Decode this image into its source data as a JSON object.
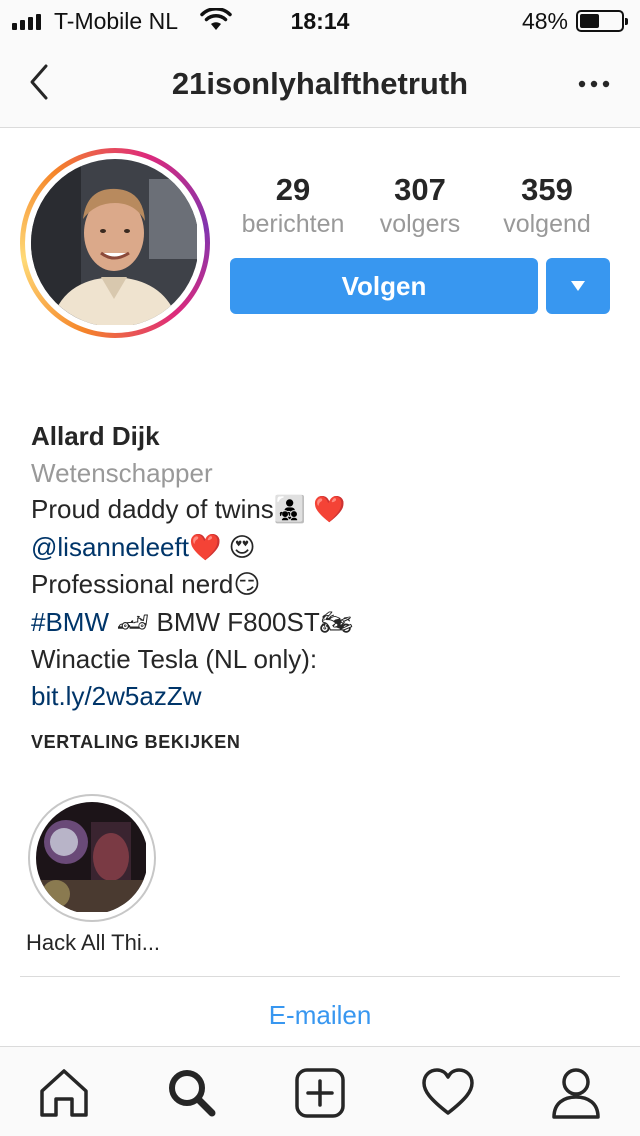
{
  "status_bar": {
    "carrier": "T-Mobile NL",
    "time": "18:14",
    "battery_percent": "48%",
    "battery_level": 0.48,
    "signal_bars": 4
  },
  "header": {
    "title": "21isonlyhalfthetruth",
    "back_icon": "chevron-left-icon",
    "more_icon": "more-horizontal-icon"
  },
  "profile": {
    "stats": [
      {
        "value": "29",
        "label": "berichten"
      },
      {
        "value": "307",
        "label": "volgers"
      },
      {
        "value": "359",
        "label": "volgend"
      }
    ],
    "follow_label": "Volgen",
    "name": "Allard Dijk",
    "category": "Wetenschapper",
    "bio": {
      "line1_text": "Proud daddy of twins",
      "line1_emoji": "👨‍👧‍👦",
      "line1_heart": "❤️",
      "line2_mention": "@lisanneleeft",
      "line2_heart": "❤️",
      "line2_emoji": "😍",
      "line3_text": "Professional nerd",
      "line3_emoji": "😏",
      "line4_hashtag": "#BMW",
      "line4_emoji_car": "🏎",
      "line4_text": "BMW F800ST",
      "line4_emoji_bike": "🏍",
      "line5_text": "Winactie Tesla (NL only):",
      "line6_link": "bit.ly/2w5azZw"
    },
    "translate_label": "VERTALING BEKIJKEN"
  },
  "highlights": [
    {
      "label": "Hack All Thi..."
    }
  ],
  "email_label": "E-mailen",
  "tabbar": {
    "items": [
      "home-icon",
      "search-icon",
      "new-post-icon",
      "activity-heart-icon",
      "profile-icon"
    ]
  },
  "colors": {
    "accent": "#3897f0",
    "link": "#003569",
    "muted": "#999999"
  }
}
